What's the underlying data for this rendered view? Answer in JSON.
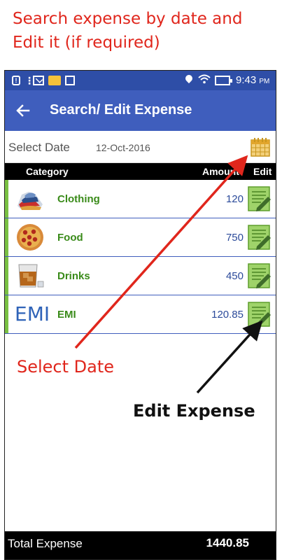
{
  "headline": {
    "line1": "Search expense by date and",
    "line2": "Edit it (if required)"
  },
  "status_bar": {
    "time": "9:43",
    "ampm": "PM",
    "icons": [
      "alert-icon",
      "more-dots-icon",
      "mail-icon",
      "folder-icon",
      "image-icon",
      "location-icon",
      "wifi-icon",
      "battery-icon"
    ]
  },
  "app_bar": {
    "title": "Search/ Edit Expense",
    "back_icon": "arrow-left-icon"
  },
  "date_filter": {
    "label": "Select Date",
    "value": "12-Oct-2016",
    "icon": "calendar-icon"
  },
  "table": {
    "headers": {
      "category": "Category",
      "amount": "Amount",
      "edit": "Edit"
    },
    "rows": [
      {
        "name": "Clothing",
        "amount": "120",
        "icon": "clothing-icon"
      },
      {
        "name": "Food",
        "amount": "750",
        "icon": "pizza-icon"
      },
      {
        "name": "Drinks",
        "amount": "450",
        "icon": "drink-glass-icon"
      },
      {
        "name": "EMI",
        "amount": "120.85",
        "icon_text": "EMI"
      }
    ]
  },
  "annotations": {
    "select_date": "Select Date",
    "edit_expense": "Edit Expense"
  },
  "footer": {
    "label": "Total Expense",
    "total": "1440.85"
  },
  "colors": {
    "app_bar": "#3f5ebd",
    "status_bar": "#2e4ea7",
    "headline": "#e0261c",
    "category_text": "#3a8b1a",
    "amount_text": "#2b4a9a",
    "row_bar": "#7ac143"
  }
}
